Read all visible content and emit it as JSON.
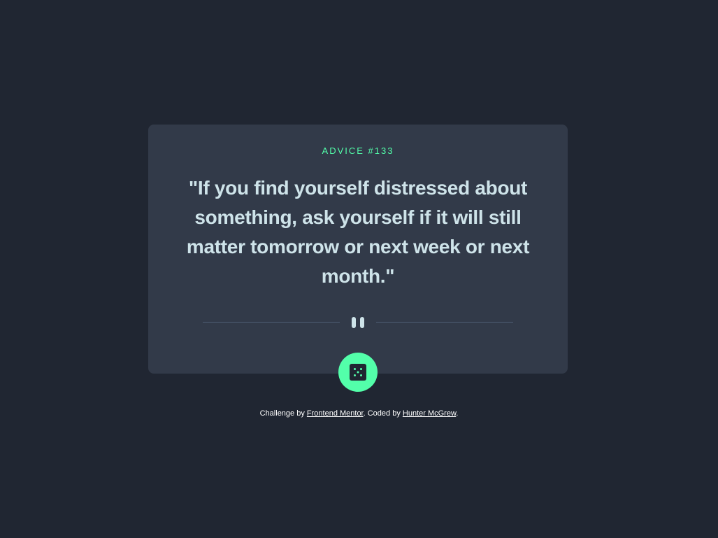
{
  "card": {
    "advice_label": "ADVICE #133",
    "quote": "\"If you find yourself distressed about something, ask yourself if it will still matter tomorrow or next week or next month.\""
  },
  "divider": {
    "icon": "pause-icon"
  },
  "dice_button": {
    "icon": "dice-icon"
  },
  "footer": {
    "prefix": "Challenge by ",
    "link1": "Frontend Mentor",
    "middle": ". Coded by ",
    "link2": "Hunter McGrew",
    "suffix": "."
  },
  "colors": {
    "background": "#202632",
    "card": "#323a49",
    "accent": "#53ffaa",
    "quote_text": "#cee3e9",
    "divider": "#4f5d74"
  }
}
